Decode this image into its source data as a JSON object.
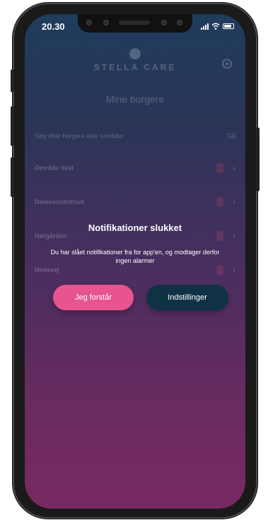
{
  "status_bar": {
    "time": "20.30"
  },
  "header": {
    "brand": "STELLA CARE"
  },
  "page": {
    "title": "Mine borgere"
  },
  "search": {
    "placeholder": "Søg efter borgere eller områder",
    "shortcut": "Gå"
  },
  "list": [
    {
      "label": "Område Vest"
    },
    {
      "label": "Demenscentrum"
    },
    {
      "label": "Hørgården"
    },
    {
      "label": "Hedevej"
    }
  ],
  "modal": {
    "title": "Notifikationer slukket",
    "message": "Du har slået notifikationer fra for app'en, og modtager derfor ingen alarmer",
    "primary_button": "Jeg forstår",
    "secondary_button": "Indstillinger"
  },
  "colors": {
    "primary_button": "#e7548f",
    "secondary_button": "#0f3245",
    "gradient_top": "#1e3c5c",
    "gradient_bottom": "#772a62"
  }
}
